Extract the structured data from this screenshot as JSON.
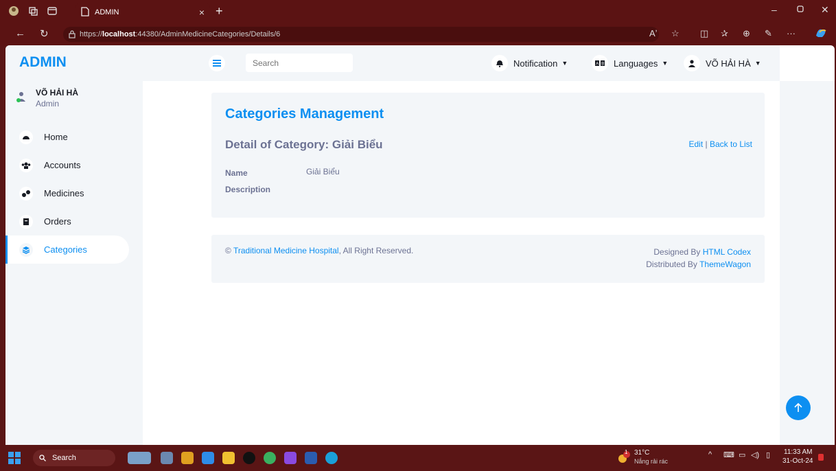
{
  "browser": {
    "tab_title": "ADMIN",
    "tab_close": "×",
    "new_tab": "+",
    "url_prefix": "https://",
    "url_host": "localhost",
    "url_path": ":44380/AdminMedicineCategories/Details/6",
    "read_aloud": "Aʼ",
    "ellipsis": "···"
  },
  "sidebar": {
    "brand": "ADMIN",
    "user_name": "VÕ HẢI HÀ",
    "user_role": "Admin",
    "items": [
      {
        "label": "Home",
        "icon": "dashboard-icon"
      },
      {
        "label": "Accounts",
        "icon": "users-icon"
      },
      {
        "label": "Medicines",
        "icon": "pills-icon"
      },
      {
        "label": "Orders",
        "icon": "file-icon"
      },
      {
        "label": "Categories",
        "icon": "layers-icon",
        "active": true
      }
    ]
  },
  "topbar": {
    "search_placeholder": "Search",
    "notification_label": "Notification",
    "languages_label": "Languages",
    "user_label": "VÕ HẢI HÀ"
  },
  "card": {
    "title": "Categories Management",
    "subtitle": "Detail of Category: Giải Biểu",
    "edit_label": "Edit",
    "separator": "|",
    "back_label": "Back to List",
    "fields": [
      {
        "label": "Name",
        "value": "Giải Biểu"
      },
      {
        "label": "Description",
        "value": ""
      }
    ]
  },
  "footer": {
    "copyright_symbol": "©",
    "hospital_link": "Traditional Medicine Hospital",
    "rights_text": ", All Right Reserved.",
    "designed_by_text": "Designed By",
    "designed_by_link": "HTML Codex",
    "distributed_by_text": "Distributed By",
    "distributed_by_link": "ThemeWagon"
  },
  "taskbar": {
    "search_label": "Search",
    "weather_temp": "31°C",
    "weather_desc": "Nắng rải rác",
    "time": "11:33 AM",
    "date": "31-Oct-24",
    "weather_badge": "1"
  },
  "colors": {
    "accent": "#0d8ff1",
    "sidebar_bg": "#f3f6f9",
    "browser_chrome": "#5b1313"
  }
}
